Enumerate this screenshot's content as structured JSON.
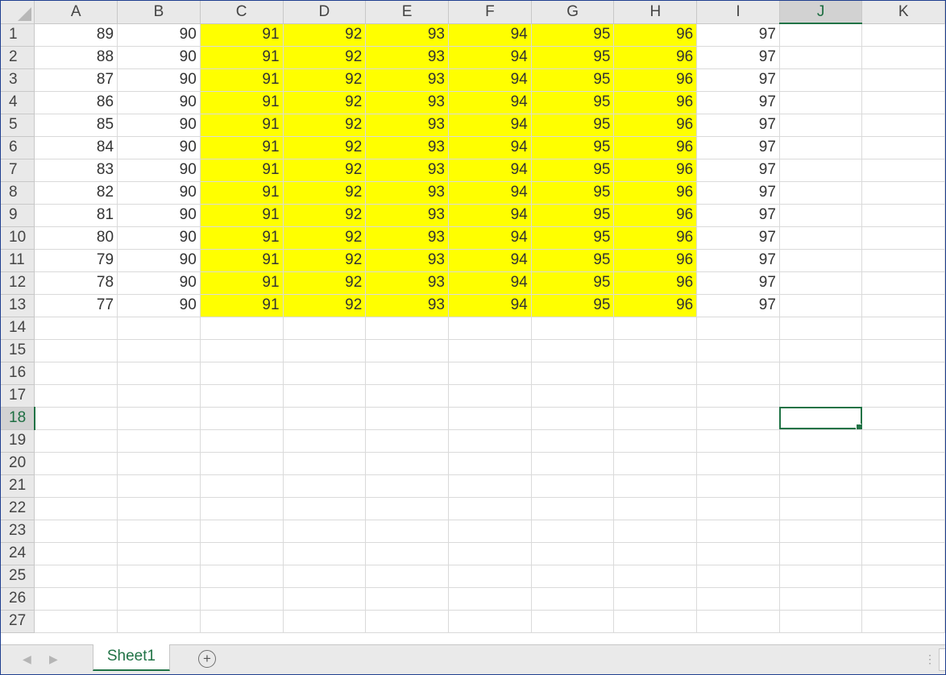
{
  "columns": [
    "A",
    "B",
    "C",
    "D",
    "E",
    "F",
    "G",
    "H",
    "I",
    "J",
    "K"
  ],
  "selected_column": "J",
  "selected_row": 18,
  "active_cell": "J18",
  "highlight_color": "#ffff00",
  "highlighted_columns": [
    "C",
    "D",
    "E",
    "F",
    "G",
    "H"
  ],
  "highlighted_rows": [
    1,
    13
  ],
  "row_count": 27,
  "cells": [
    [
      89,
      90,
      91,
      92,
      93,
      94,
      95,
      96,
      97
    ],
    [
      88,
      90,
      91,
      92,
      93,
      94,
      95,
      96,
      97
    ],
    [
      87,
      90,
      91,
      92,
      93,
      94,
      95,
      96,
      97
    ],
    [
      86,
      90,
      91,
      92,
      93,
      94,
      95,
      96,
      97
    ],
    [
      85,
      90,
      91,
      92,
      93,
      94,
      95,
      96,
      97
    ],
    [
      84,
      90,
      91,
      92,
      93,
      94,
      95,
      96,
      97
    ],
    [
      83,
      90,
      91,
      92,
      93,
      94,
      95,
      96,
      97
    ],
    [
      82,
      90,
      91,
      92,
      93,
      94,
      95,
      96,
      97
    ],
    [
      81,
      90,
      91,
      92,
      93,
      94,
      95,
      96,
      97
    ],
    [
      80,
      90,
      91,
      92,
      93,
      94,
      95,
      96,
      97
    ],
    [
      79,
      90,
      91,
      92,
      93,
      94,
      95,
      96,
      97
    ],
    [
      78,
      90,
      91,
      92,
      93,
      94,
      95,
      96,
      97
    ],
    [
      77,
      90,
      91,
      92,
      93,
      94,
      95,
      96,
      97
    ]
  ],
  "sheet_tabs": [
    {
      "label": "Sheet1",
      "active": true
    }
  ],
  "icons": {
    "prev": "triangle-left-icon",
    "next": "triangle-right-icon",
    "add": "plus-circle-icon",
    "splitter": "vertical-dots-icon"
  },
  "accent_color": "#217346"
}
